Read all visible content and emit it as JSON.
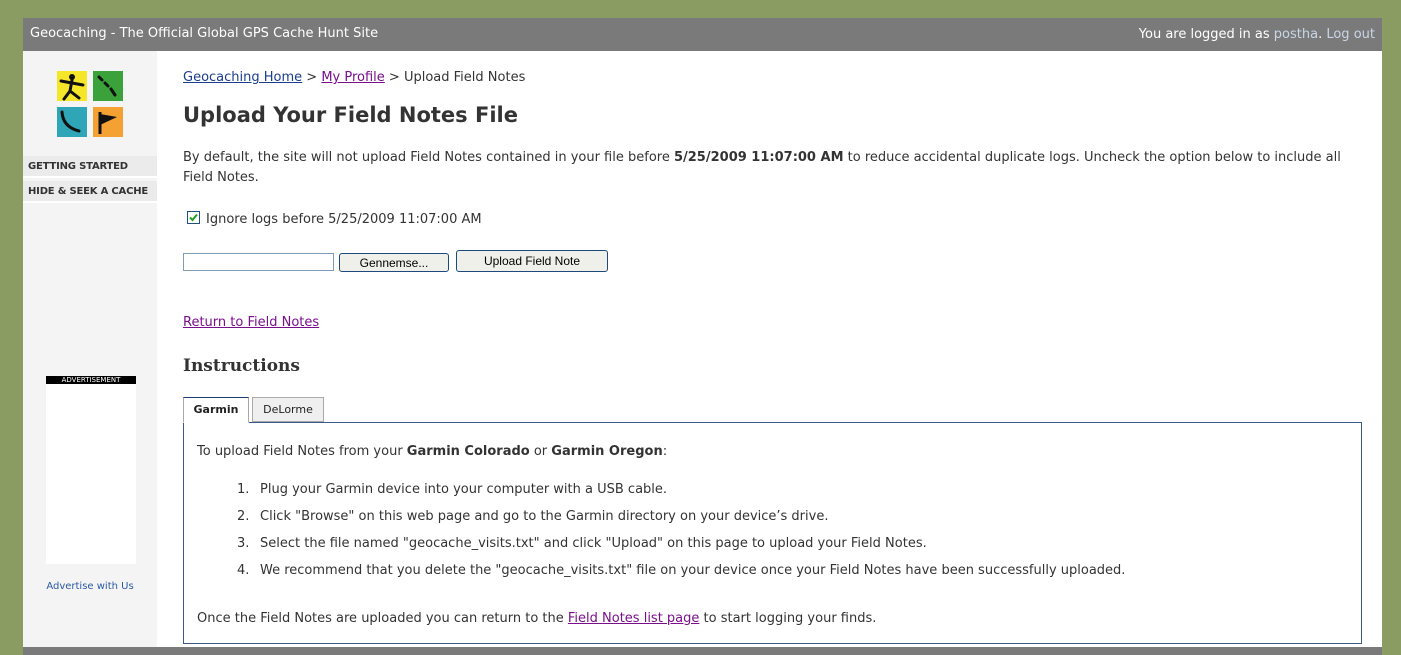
{
  "header": {
    "site_title": "Geocaching - The Official Global GPS Cache Hunt Site",
    "login_prefix": "You are logged in as ",
    "username": "postha",
    "logout": "Log out",
    "separator": ". "
  },
  "sidebar": {
    "items": [
      {
        "label": "GETTING STARTED"
      },
      {
        "label": "HIDE & SEEK A CACHE"
      }
    ],
    "ad_label": "ADVERTISEMENT",
    "advertise_link": "Advertise with Us"
  },
  "breadcrumb": {
    "home": "Geocaching Home",
    "profile": "My Profile",
    "current": "Upload Field Notes",
    "separator": " > "
  },
  "page_title": "Upload Your Field Notes File",
  "intro": {
    "part1": "By default, the site will not upload Field Notes contained in your file before ",
    "date": "5/25/2009 11:07:00 AM",
    "part2": " to reduce accidental duplicate logs. Uncheck the option below to include all Field Notes."
  },
  "ignore_option": {
    "label": "Ignore logs before 5/25/2009 11:07:00 AM",
    "checked": true
  },
  "upload": {
    "file_value": "",
    "browse_label": "Gennemse...",
    "submit_label": "Upload Field Note"
  },
  "return_link": "Return to Field Notes",
  "instructions": {
    "heading": "Instructions",
    "tabs": [
      {
        "label": "Garmin",
        "active": true
      },
      {
        "label": "DeLorme",
        "active": false
      }
    ],
    "lead_prefix": "To upload Field Notes from your ",
    "device1": "Garmin Colorado",
    "lead_or": " or ",
    "device2": "Garmin Oregon",
    "lead_suffix": ":",
    "steps": [
      {
        "num": "1.",
        "text": "Plug your Garmin device into your computer with a USB cable."
      },
      {
        "num": "2.",
        "text": "Click \"Browse\" on this web page and go to the Garmin directory on your device’s drive."
      },
      {
        "num": "3.",
        "text": "Select the file named \"geocache_visits.txt\" and click \"Upload\" on this page to upload your Field Notes."
      },
      {
        "num": "4.",
        "text": "We recommend that you delete the \"geocache_visits.txt\" file on your device once your Field Notes have been successfully uploaded."
      }
    ],
    "closing_prefix": "Once the Field Notes are uploaded you can return to the ",
    "closing_link": "Field Notes list page",
    "closing_suffix": " to start logging your finds."
  },
  "colors": {
    "background": "#8b9c62",
    "header_bar": "#7a7a7a",
    "link": "#1b3d8f",
    "visited_link": "#7a0f8c",
    "logo_yellow": "#f5e62a",
    "logo_green": "#3ba13a",
    "logo_teal": "#2fa6b8",
    "logo_orange": "#f5a033"
  }
}
